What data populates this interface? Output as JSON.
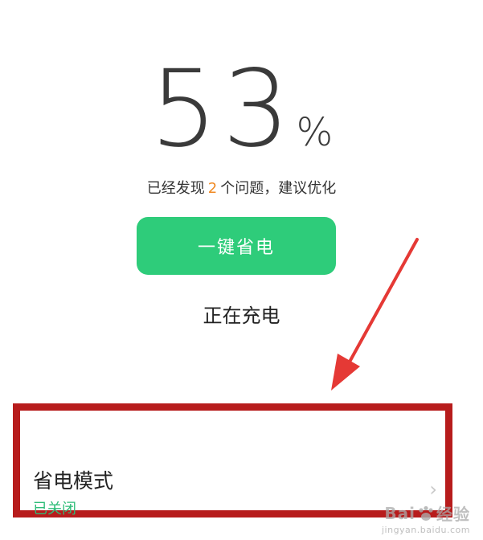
{
  "battery": {
    "percent": "53",
    "percent_sign": "%"
  },
  "issues": {
    "prefix": "已经发现",
    "count": "2",
    "suffix": "个问题，建议优化"
  },
  "optimize_button": {
    "label": "一键省电"
  },
  "charging_status": "正在充电",
  "power_saving_mode": {
    "title": "省电模式",
    "status": "已关闭"
  },
  "watermark": {
    "brand_left": "Bai",
    "brand_right": "经验",
    "url": "jingyan.baidu.com"
  },
  "colors": {
    "accent_green": "#2ecc7a",
    "status_green": "#2ebc78",
    "highlight_red": "#b71c1c",
    "arrow_red": "#e53935",
    "issue_count": "#f08a24"
  }
}
